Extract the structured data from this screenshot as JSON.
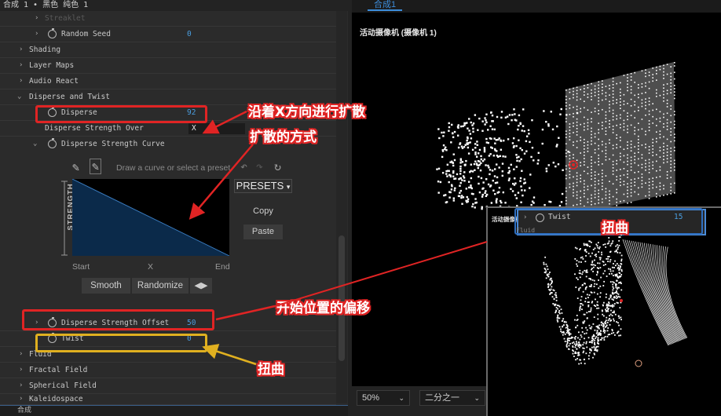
{
  "left_panel": {
    "header": "合成 1 • 黑色 纯色 1",
    "rows": [
      {
        "label": "Streaklet",
        "value": ""
      },
      {
        "label": "Random Seed",
        "value": "0"
      },
      {
        "label": "Shading",
        "value": ""
      },
      {
        "label": "Layer Maps",
        "value": ""
      },
      {
        "label": "Audio React",
        "value": ""
      },
      {
        "label": "Disperse and Twist",
        "value": ""
      },
      {
        "label": "Disperse",
        "value": "92"
      },
      {
        "label": "Disperse Strength Over",
        "value": "X"
      },
      {
        "label": "Disperse Strength Curve",
        "value": ""
      },
      {
        "label": "Disperse Strength Offset",
        "value": "50"
      },
      {
        "label": "Twist",
        "value": "0"
      },
      {
        "label": "Fluid",
        "value": ""
      },
      {
        "label": "Fractal Field",
        "value": ""
      },
      {
        "label": "Spherical Field",
        "value": ""
      },
      {
        "label": "Kaleidospace",
        "value": ""
      }
    ],
    "footer": "合成"
  },
  "curve_editor": {
    "hint": "Draw a curve or select a preset",
    "axis_label": "STRENGTH",
    "x_start": "Start",
    "x_mid": "X",
    "x_end": "End",
    "presets": "PRESETS",
    "copy": "Copy",
    "paste": "Paste",
    "smooth": "Smooth",
    "randomize": "Randomize"
  },
  "viewer": {
    "tab": "合成1",
    "camera_label": "活动摄像机 (摄像机 1)",
    "zoom": "50%",
    "resolution": "二分之一"
  },
  "inset": {
    "camera_label": "活动摄像机",
    "twist_label": "Twist",
    "twist_value": "15",
    "fluid_label": "Fluid"
  },
  "annotations": {
    "disperse_x": "沿着X方向进行扩散",
    "disperse_mode": "扩散的方式",
    "offset": "开始位置的偏移",
    "twist_left": "扭曲",
    "twist_right": "扭曲"
  },
  "colors": {
    "accent_blue": "#4a9ee0",
    "annotation_red": "#e02424",
    "annotation_yellow": "#e0b020",
    "curve_fill": "#0b2a4a"
  }
}
